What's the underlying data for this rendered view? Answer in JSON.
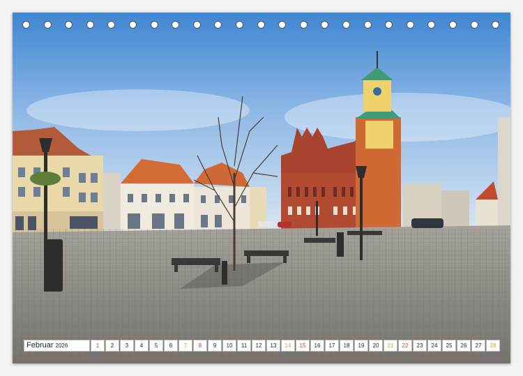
{
  "calendar": {
    "month": "Februar",
    "year": "2026",
    "days": [
      {
        "n": "1",
        "t": "sun"
      },
      {
        "n": "2",
        "t": "wd"
      },
      {
        "n": "3",
        "t": "wd"
      },
      {
        "n": "4",
        "t": "wd"
      },
      {
        "n": "5",
        "t": "wd"
      },
      {
        "n": "6",
        "t": "wd"
      },
      {
        "n": "7",
        "t": "sat"
      },
      {
        "n": "8",
        "t": "sun"
      },
      {
        "n": "9",
        "t": "wd"
      },
      {
        "n": "10",
        "t": "wd"
      },
      {
        "n": "11",
        "t": "wd"
      },
      {
        "n": "12",
        "t": "wd"
      },
      {
        "n": "13",
        "t": "wd"
      },
      {
        "n": "14",
        "t": "sat"
      },
      {
        "n": "15",
        "t": "sun"
      },
      {
        "n": "16",
        "t": "wd"
      },
      {
        "n": "17",
        "t": "wd"
      },
      {
        "n": "18",
        "t": "wd"
      },
      {
        "n": "19",
        "t": "wd"
      },
      {
        "n": "20",
        "t": "wd"
      },
      {
        "n": "21",
        "t": "sat"
      },
      {
        "n": "22",
        "t": "sun"
      },
      {
        "n": "23",
        "t": "wd"
      },
      {
        "n": "24",
        "t": "wd"
      },
      {
        "n": "25",
        "t": "wd"
      },
      {
        "n": "26",
        "t": "wd"
      },
      {
        "n": "27",
        "t": "wd"
      },
      {
        "n": "28",
        "t": "sat"
      }
    ]
  },
  "binding": {
    "hole_count": 23
  },
  "colors": {
    "sunday": "#d43a2a",
    "saturday": "#d99a2a",
    "sky_top": "#3f86d2",
    "pavement": "#8e8a84"
  }
}
